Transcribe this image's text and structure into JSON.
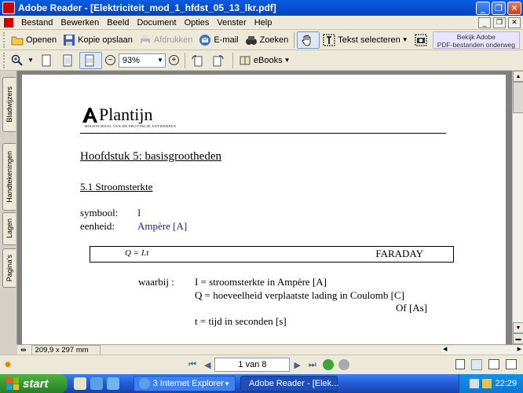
{
  "window": {
    "title": "Adobe Reader - [Elektriciteit_mod_1_hfdst_05_13_lkr.pdf]"
  },
  "menu": [
    "Bestand",
    "Bewerken",
    "Beeld",
    "Document",
    "Opties",
    "Venster",
    "Help"
  ],
  "toolbar1": {
    "open": "Openen",
    "save_copy": "Kopie opslaan",
    "print": "Afdrukken",
    "email": "E-mail",
    "search": "Zoeken",
    "select_text": "Tekst selecteren",
    "promo_line1": "Bekijk Adobe",
    "promo_line2": "PDF-bestanden onderweg"
  },
  "toolbar2": {
    "zoom": "93%",
    "ebooks": "eBooks"
  },
  "nav_tabs": [
    "Bladwijzers",
    "Handtekeningen",
    "Lagen",
    "Pagina's"
  ],
  "document": {
    "logo_text": "Plantijn",
    "logo_subtitle": "HOGESCHOOL VAN DE PROVINCIE ANTWERPEN",
    "heading": "Hoofdstuk 5: basisgrootheden",
    "subheading": "5.1 Stroomsterkte",
    "symbol_label": "symbool:",
    "symbol_value": "I",
    "unit_label": "eenheid:",
    "unit_value": "Ampère [A]",
    "formula": "Q = I.t",
    "formula_name": "FARADAY",
    "where_label": "waarbij :",
    "def_i": "I = stroomsterkte in Ampère [A]",
    "def_q": "Q = hoeveelheid verplaatste lading in Coulomb [C]",
    "def_q_alt": "Of  [As]",
    "def_t": "t = tijd in seconden [s]"
  },
  "status": {
    "page_size": "209,9 x 297 mm"
  },
  "navigation": {
    "page_indicator": "1 van 8"
  },
  "taskbar": {
    "start": "start",
    "task_ie": "3 Internet Explorer",
    "task_reader": "Adobe Reader - [Elek...",
    "clock": "22:29"
  }
}
